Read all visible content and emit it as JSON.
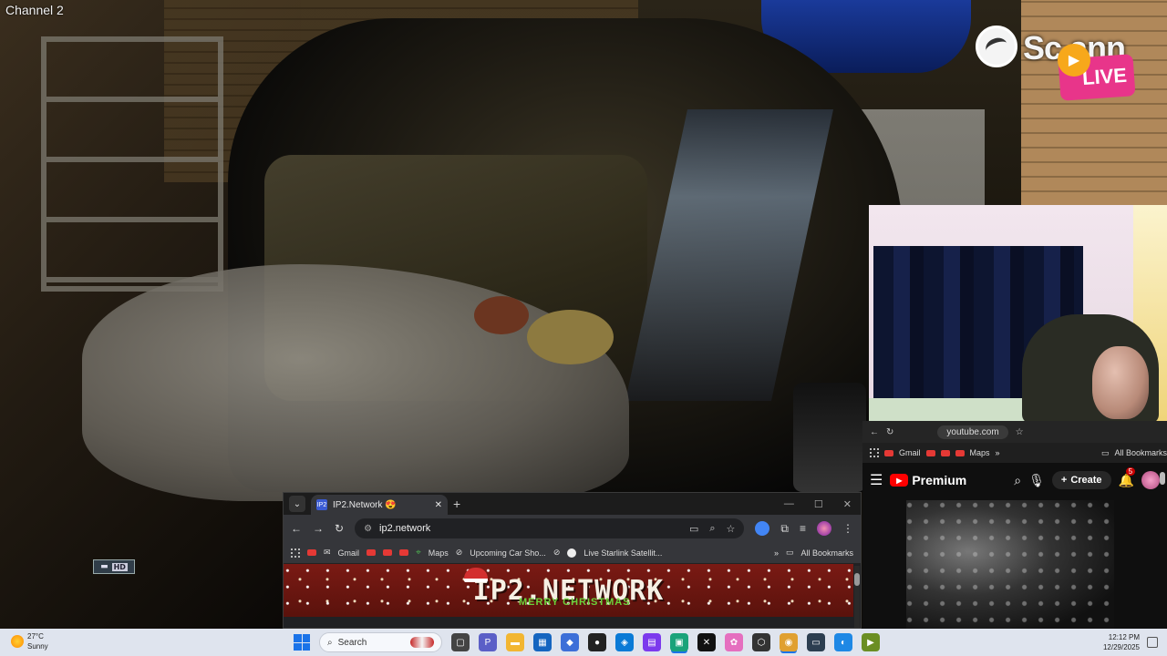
{
  "camera": {
    "channel_label": "Channel 2",
    "hd_badge": "HD"
  },
  "stream_overlay": {
    "brand_text": "Sc  ann",
    "live_label": "LIVE"
  },
  "youtube_window": {
    "url": "youtube.com",
    "bookmarks": {
      "gmail": "Gmail",
      "maps": "Maps",
      "all_bookmarks": "All Bookmarks"
    },
    "header": {
      "logo_text": "Premium",
      "create_label": "Create",
      "notification_count": "5"
    }
  },
  "chrome_window": {
    "tab_title": "IP2.Network 😍",
    "tab_favicon_text": "IP2",
    "url": "ip2.network",
    "bookmarks": {
      "gmail": "Gmail",
      "maps": "Maps",
      "upcoming": "Upcoming Car Sho...",
      "starlink": "Live Starlink Satellit...",
      "all_bookmarks": "All Bookmarks"
    },
    "banner": {
      "brand": "IP2.NETWORK",
      "subtitle": "MERRY CHRISTMAS"
    }
  },
  "taskbar": {
    "weather_temp": "27°C",
    "weather_desc": "Sunny",
    "search_placeholder": "Search",
    "time": "12:12 PM",
    "date": "12/29/2025"
  },
  "colors": {
    "youtube_red": "#ff0000",
    "live_pink": "#e8358a",
    "taskbar_bg": "#dfe4ee"
  }
}
